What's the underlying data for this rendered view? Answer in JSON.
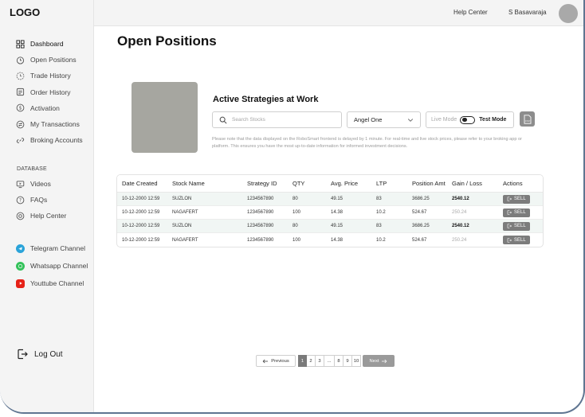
{
  "app": {
    "logo": "LOGO"
  },
  "topbar": {
    "help_center": "Help Center",
    "user_name": "S Basavaraja"
  },
  "sidebar": {
    "items": [
      {
        "label": "Dashboard",
        "icon": "dashboard-icon"
      },
      {
        "label": "Open Positions",
        "icon": "clock-icon"
      },
      {
        "label": "Trade History",
        "icon": "history-icon"
      },
      {
        "label": "Order History",
        "icon": "list-icon"
      },
      {
        "label": "Activation",
        "icon": "dollar-icon"
      },
      {
        "label": "My Transactions",
        "icon": "exchange-icon"
      },
      {
        "label": "Broking Accounts",
        "icon": "link-icon"
      }
    ],
    "section_label": "DATABASE",
    "database_items": [
      {
        "label": "Videos",
        "icon": "video-icon"
      },
      {
        "label": "FAQs",
        "icon": "info-icon"
      },
      {
        "label": "Help Center",
        "icon": "help-icon"
      }
    ],
    "channels": [
      {
        "label": "Telegram Channel",
        "icon": "telegram-icon",
        "color": "#2aa3d9"
      },
      {
        "label": "Whatsapp Channel",
        "icon": "whatsapp-icon",
        "color": "#34c25a"
      },
      {
        "label": "Youttube Channel",
        "icon": "youtube-icon",
        "color": "#e62117"
      }
    ],
    "logout": "Log Out"
  },
  "main": {
    "title": "Open Positions",
    "strategy_title": "Active Strategies at Work",
    "search_placeholder": "Search Stocks",
    "broker": "Angel One",
    "live_mode": "Live Mode",
    "test_mode": "Test Mode",
    "csv_label": "CSV",
    "notice": "Please note that the data displayed on the RoboSmart frontend is delayed by 1 minute. For real-time and live stock prices, please refer to your broking app or platform. This ensures you have the most up-to-date information for informed investment decisions."
  },
  "table": {
    "headers": [
      "Date Created",
      "Stock Name",
      "Strategy ID",
      "QTY",
      "Avg. Price",
      "LTP",
      "Position Amt",
      "Gain / Loss",
      "Actions"
    ],
    "rows": [
      {
        "date": "10-12-2000  12:59",
        "stock": "SUZLON",
        "strategy_id": "1234567890",
        "qty": "80",
        "avg_price": "49.15",
        "ltp": "83",
        "position_amt": "3686.25",
        "gain_loss": "2540.12",
        "gain_type": "positive",
        "action": "SELL"
      },
      {
        "date": "10-12-2000  12:59",
        "stock": "NAGAFERT",
        "strategy_id": "1234567890",
        "qty": "100",
        "avg_price": "14.38",
        "ltp": "10.2",
        "position_amt": "524.67",
        "gain_loss": "250.24",
        "gain_type": "negative",
        "action": "SELL"
      },
      {
        "date": "10-12-2000  12:59",
        "stock": "SUZLON",
        "strategy_id": "1234567890",
        "qty": "80",
        "avg_price": "49.15",
        "ltp": "83",
        "position_amt": "3686.25",
        "gain_loss": "2540.12",
        "gain_type": "positive",
        "action": "SELL"
      },
      {
        "date": "10-12-2000  12:59",
        "stock": "NAGAFERT",
        "strategy_id": "1234567890",
        "qty": "100",
        "avg_price": "14.38",
        "ltp": "10.2",
        "position_amt": "524.67",
        "gain_loss": "250.24",
        "gain_type": "negative",
        "action": "SELL"
      }
    ]
  },
  "pagination": {
    "previous": "Previous",
    "next": "Next",
    "pages": [
      "1",
      "2",
      "3",
      "...",
      "8",
      "9",
      "10"
    ],
    "current": "1"
  }
}
